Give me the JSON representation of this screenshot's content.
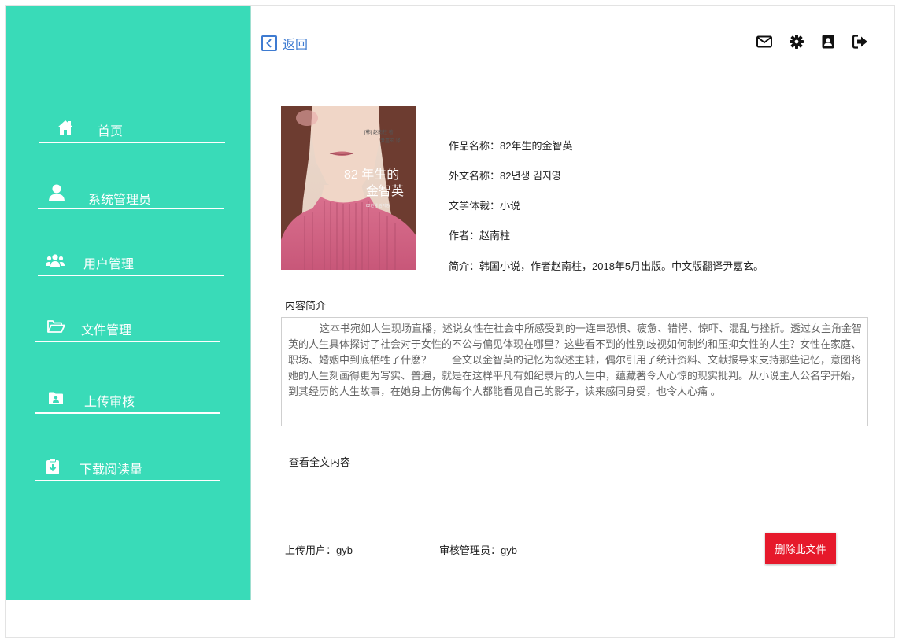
{
  "sidebar": {
    "bg_color": "#39dbb8",
    "items": [
      {
        "label": "首页",
        "icon": "home-icon"
      },
      {
        "label": "系统管理员",
        "icon": "user-icon"
      },
      {
        "label": "用户管理",
        "icon": "users-icon"
      },
      {
        "label": "文件管理",
        "icon": "folder-open-icon"
      },
      {
        "label": "上传审核",
        "icon": "folder-user-icon"
      },
      {
        "label": "下载阅读量",
        "icon": "clipboard-download-icon"
      }
    ]
  },
  "header": {
    "back_label": "返回",
    "icons": [
      "mail-icon",
      "settings-icon",
      "profile-icon",
      "logout-icon"
    ],
    "accent_color": "#3e7bd1"
  },
  "book": {
    "cover": {
      "title_line1": "82 年生的",
      "title_line2": "金智英",
      "small_text_1": "[韩] 赵南柱 著",
      "small_text_2": "尹嘉玄 译",
      "small_text_3": "82년생 김지영"
    },
    "title": "作品名称：82年生的金智英",
    "foreign_title": "外文名称：82년생 김지영",
    "genre": "文学体裁：小说",
    "author": "作者：赵南柱",
    "brief": "简介：韩国小说，作者赵南柱，2018年5月出版。中文版翻译尹嘉玄。"
  },
  "content": {
    "section_title": "内容简介",
    "summary": "这本书宛如人生现场直播，述说女性在社会中所感受到的一连串恐惧、疲惫、错愕、惊吓、混乱与挫折。透过女主角金智英的人生具体探讨了社会对于女性的不公与偏见体现在哪里？这些看不到的性别歧视如何制约和压抑女性的人生？女性在家庭、职场、婚姻中到底牺牲了什麽？　　全文以金智英的记忆为叙述主轴，偶尔引用了统计资料、文献报导来支持那些记忆，意图将她的人生刻画得更为写实、普遍，就是在这样平凡有如纪录片的人生中，蕴藏著令人心惊的现实批判。从小说主人公名字开始，到其经历的人生故事，在她身上仿佛每个人都能看见自己的影子，读来感同身受，也令人心痛 。",
    "view_full_label": "查看全文内容"
  },
  "footer": {
    "uploader": "上传用户：gyb",
    "reviewer": "审核管理员：gyb",
    "delete_label": "删除此文件",
    "delete_color": "#e6192b"
  }
}
